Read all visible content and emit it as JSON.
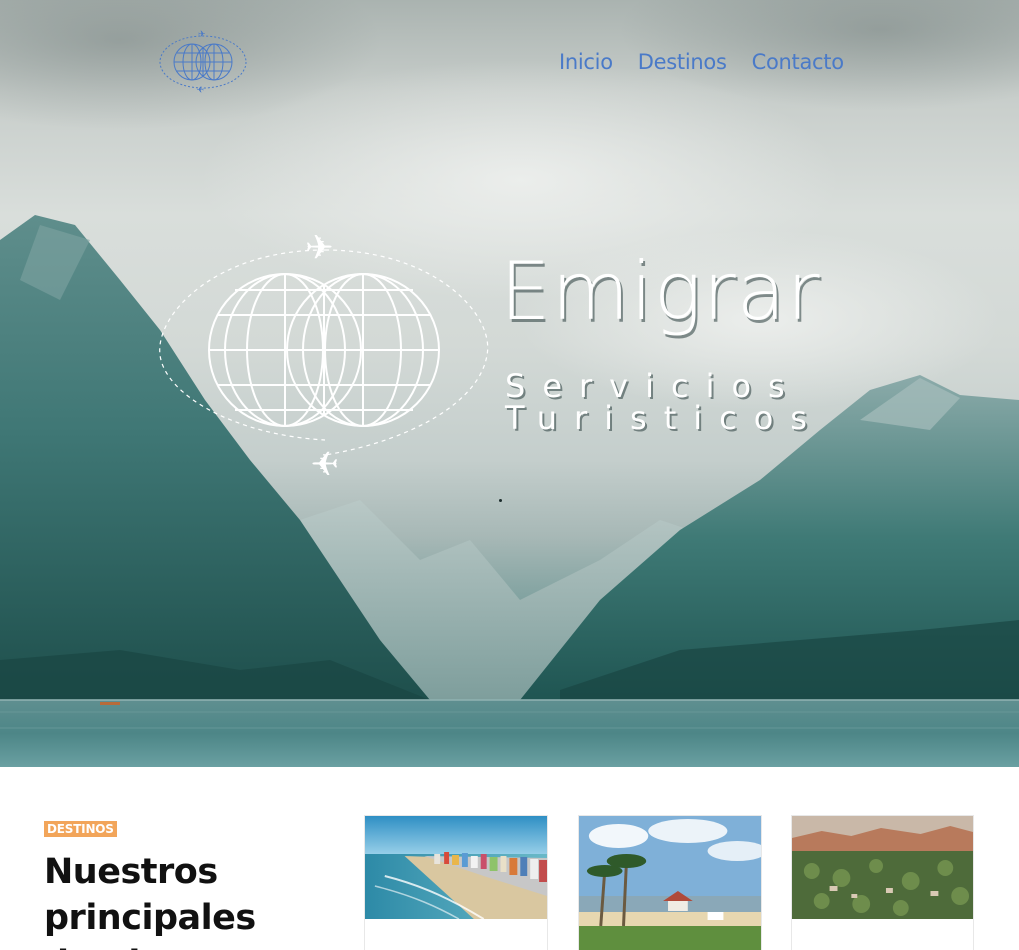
{
  "nav": {
    "items": [
      {
        "label": "Inicio"
      },
      {
        "label": "Destinos"
      },
      {
        "label": "Contacto"
      }
    ],
    "color": "#4a7ac8"
  },
  "hero": {
    "title": "Emigrar",
    "subtitle_line1": "Servicios",
    "subtitle_line2": "Turisticos"
  },
  "section": {
    "tag": "DESTINOS",
    "tag_color": "#f2a55a",
    "headline": "Nuestros principales destinos"
  },
  "cards": [
    {
      "name": "beach-city"
    },
    {
      "name": "palm-lakeside"
    },
    {
      "name": "mountain-town"
    }
  ]
}
